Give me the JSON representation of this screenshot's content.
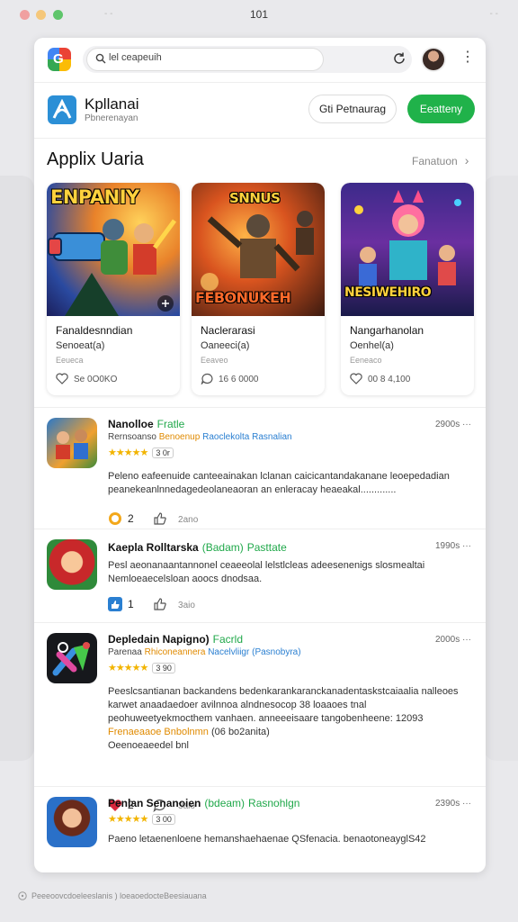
{
  "titlebar": {
    "title": "101",
    "left_mark": "- -",
    "right_mark": "- -",
    "colors": {
      "close": "#f0a0a0",
      "minimize": "#f5c77a",
      "zoom": "#5fc56b"
    }
  },
  "toolbar": {
    "search_value": "lel ceapeuih",
    "reload_icon": "reload-icon",
    "menu_icon": "kebab-menu-icon"
  },
  "header": {
    "app_name": "Kpllanai",
    "app_subtitle": "Pbnerenayan",
    "secondary_button": "Gti Petnaurag",
    "primary_button": "Eeatteny",
    "accent_color": "#20b24a"
  },
  "section": {
    "title": "Applix Uaria",
    "link": "Fanatuon"
  },
  "cards": [
    {
      "art_title": "ENPANIY",
      "title": "Fanaldesnndian",
      "subtitle": "Senoeat(a)",
      "meta": "Eeueca",
      "stat": "Se 0O0KO",
      "stat_icon": "heart-icon"
    },
    {
      "art_title": "FEBONUKEH",
      "art_top": "SNNUS",
      "title": "Naclerarasi",
      "subtitle": "Oaneeci(a)",
      "meta": "Eeaveo",
      "stat": "16 6 0000",
      "stat_icon": "comment-icon"
    },
    {
      "art_title": "NESIWEHIRO",
      "title": "Nangarhanolan",
      "subtitle": "Oenhel(a)",
      "meta": "Eeneaco",
      "stat": "00 8 4,100",
      "stat_icon": "heart-icon"
    }
  ],
  "posts": [
    {
      "title": "Nanolloe",
      "tag1": "Fratle",
      "time": "2900s",
      "line2_a": "Rernsoanso",
      "line2_b": "Benoenup",
      "line2_c": "Raoclekolta",
      "line2_d": "Rasnalian",
      "rating_count": "3 0r",
      "body": "Peleno eafeenuide canteeainakan lclanan caicicantandakanane leoepedadian peanekeanlnnedagedeolaneaoran an enleracay heaeakal.............",
      "action1_count": "2",
      "action2_count": "2ano",
      "action1_icon": "coin-icon",
      "action2_icon": "thumbs-up-icon"
    },
    {
      "title": "Kaepla Rolltarska",
      "tag1": "(Badam)",
      "tag2": "Pasttate",
      "time": "1990s",
      "body": "Pesl aeonanaantannonel ceaeeolal lelstlcleas adeesenenigs slosmealtai Nemloeaecelsloan aoocs dnodsaa.",
      "action1_count": "1",
      "action2_count": "3aio",
      "action1_icon": "like-icon",
      "action2_icon": "thumbs-up-icon"
    },
    {
      "title": "Depledain Napigno)",
      "tag1": "Facrld",
      "time": "2000s",
      "line2_a": "Parenaa",
      "line2_b": "Rhiconeannera",
      "line2_c": "Nacelvliigr",
      "line2_d": "(Pasnobyra)",
      "rating_count": "3 90",
      "body": "Peeslcsantianan backandens bedenkarankaranckanadentaskstcaiaalia nalleoes karwet anaadaedoer avilnnoa alndnesocop 38 loaaoes tnal peohuweetyekmocthem vanhaen. anneeeisaare tangobenheene: 12093",
      "body_highlight": "Frenaeaaoe Bnbolnmn",
      "body_highlight_tail": "(06 bo2anita)",
      "body_tail": "Oeenoeaeedel bnl",
      "action1_count": "2",
      "action2_count": "3aio",
      "action1_icon": "heart-icon",
      "action2_icon": "comment-icon"
    },
    {
      "title": "Penlan Senanoien",
      "tag1": "(bdeam)",
      "tag2": "Rasnohlgn",
      "time": "2390s",
      "rating_count": "3 00",
      "body": "Paeno letaenenloene hemanshaehaenae QSfenacia. benaotoneayglS42"
    }
  ],
  "footer": {
    "text": "Peeeoovcdoeleeslanis ) loeaoedocteBeesiauana",
    "icon": "info-circle-icon"
  }
}
